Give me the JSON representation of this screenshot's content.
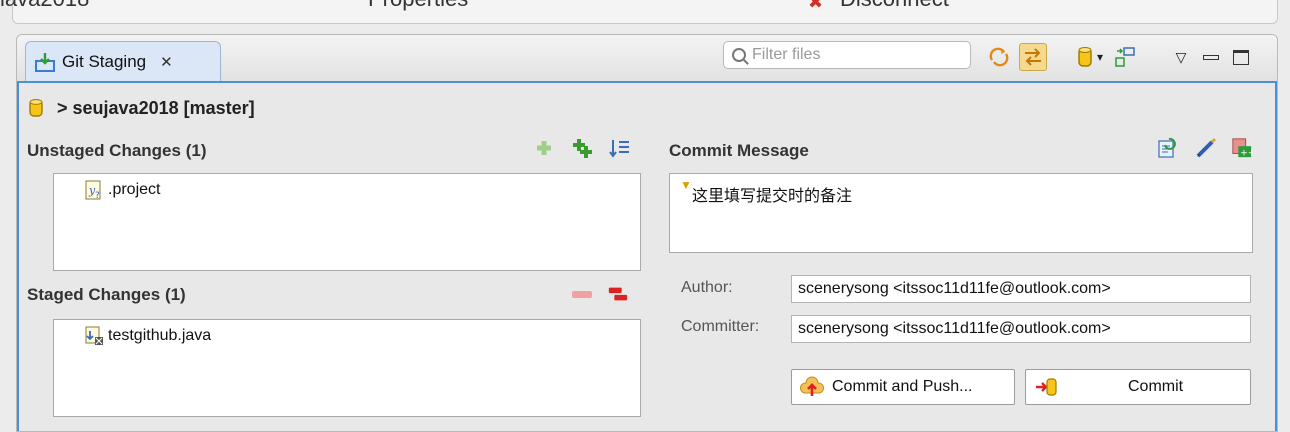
{
  "top_strip": {
    "left_cut": "iava2018",
    "mid_cut": "Properties",
    "right_cut": "Disconnect",
    "disconnect_icon": "disconnect-icon"
  },
  "view": {
    "tab": {
      "label": "Git Staging",
      "icon": "git-staging-icon",
      "close": "✕"
    },
    "filter": {
      "placeholder": "Filter files",
      "value": ""
    },
    "toolbar": [
      "refresh-icon",
      "link-with-selection-icon",
      "repository-icon",
      "dropdown-icon",
      "presentation-icon",
      "view-menu-icon",
      "minimize-icon",
      "maximize-icon"
    ]
  },
  "repo": {
    "label": "> seujava2018 [master]",
    "icon": "repository-icon"
  },
  "unstaged": {
    "title": "Unstaged Changes",
    "count": "(1)",
    "files": [
      {
        "name": ".project",
        "icon": "unknown-file-icon"
      }
    ],
    "actions": [
      "add-icon",
      "add-all-icon",
      "sort-icon"
    ]
  },
  "staged": {
    "title": "Staged Changes",
    "count": "(1)",
    "files": [
      {
        "name": "testgithub.java",
        "icon": "java-file-icon"
      }
    ],
    "actions": [
      "remove-icon",
      "remove-all-icon"
    ]
  },
  "commit": {
    "title": "Commit Message",
    "message": "这里填写提交时的备注",
    "actions": [
      "amend-icon",
      "sign-off-icon",
      "add-change-id-icon"
    ],
    "author_label": "Author:",
    "author_value": "scenerysong <itssoc11d11fe@outlook.com>",
    "committer_label": "Committer:",
    "committer_value": "scenerysong <itssoc11d11fe@outlook.com>",
    "commit_push_label": "Commit and Push...",
    "commit_label": "Commit"
  },
  "colors": {
    "accent": "#4a90d9",
    "tab_bg": "#dbe7f6",
    "pressed": "#f5d98f"
  }
}
